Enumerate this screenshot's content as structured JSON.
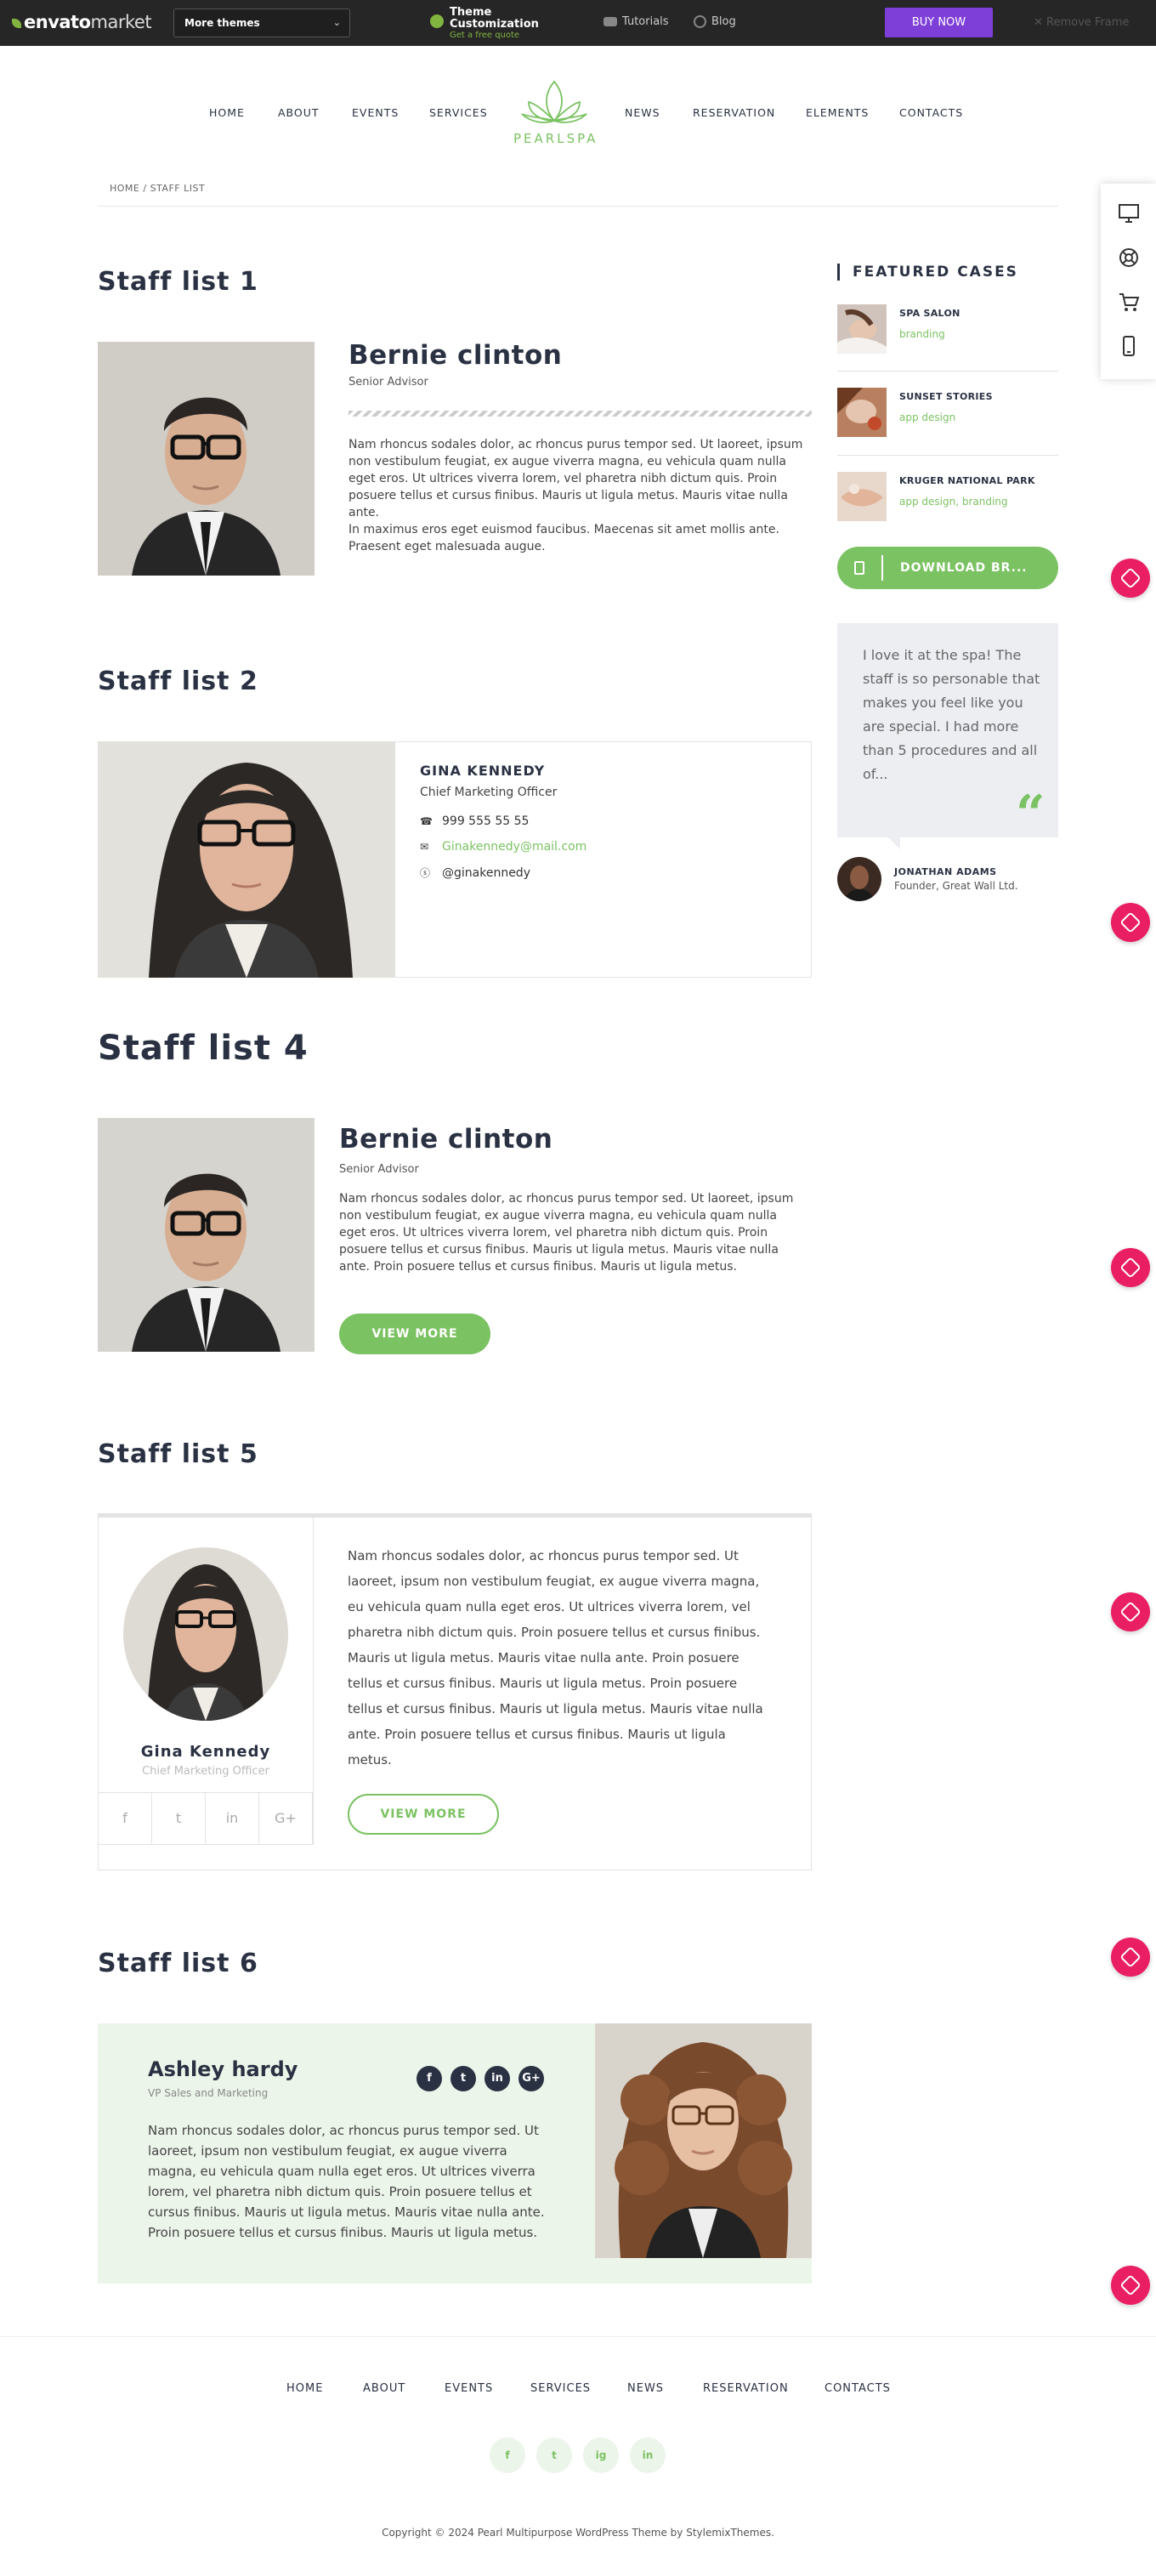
{
  "envato": {
    "logo_brand": "envato",
    "logo_market": "market",
    "more_themes": "More themes",
    "theme_customization": "Theme Customization",
    "free_quote": "Get a free quote",
    "tutorials": "Tutorials",
    "blog": "Blog",
    "buy_now": "BUY NOW",
    "remove_frame": "Remove Frame"
  },
  "nav": {
    "left": [
      "HOME",
      "ABOUT",
      "EVENTS",
      "SERVICES"
    ],
    "right": [
      "NEWS",
      "RESERVATION",
      "ELEMENTS",
      "CONTACTS"
    ],
    "logo_text": "PEARLSPA"
  },
  "breadcrumb": "HOME / STAFF LIST",
  "staff1": {
    "title": "Staff list 1",
    "name": "Bernie clinton",
    "position": "Senior Advisor",
    "bio": "Nam rhoncus sodales dolor, ac rhoncus purus tempor sed. Ut laoreet, ipsum non vestibulum feugiat, ex augue viverra magna, eu vehicula quam nulla eget eros. Ut ultrices viverra lorem, vel pharetra nibh dictum quis. Proin posuere tellus et cursus finibus. Mauris ut ligula metus. Mauris vitae nulla ante.",
    "bio2": "In maximus eros eget euismod faucibus. Maecenas sit amet mollis ante. Praesent eget malesuada augue."
  },
  "staff2": {
    "title": "Staff list 2",
    "name": "GINA KENNEDY",
    "position": "Chief Marketing Officer",
    "phone": "999 555 55 55",
    "email": "Ginakennedy@mail.com",
    "skype": "@ginakennedy"
  },
  "staff4": {
    "title": "Staff list 4",
    "name": "Bernie clinton",
    "position": "Senior Advisor",
    "bio": "Nam rhoncus sodales dolor, ac rhoncus purus tempor sed. Ut laoreet, ipsum non vestibulum feugiat, ex augue viverra magna, eu vehicula quam nulla eget eros. Ut ultrices viverra lorem, vel pharetra nibh dictum quis. Proin posuere tellus et cursus finibus. Mauris ut ligula metus. Mauris vitae nulla ante. Proin posuere tellus et cursus finibus. Mauris ut ligula metus.",
    "button": "VIEW MORE"
  },
  "staff5": {
    "title": "Staff list 5",
    "name": "Gina Kennedy",
    "position": "Chief Marketing Officer",
    "bio": "Nam rhoncus sodales dolor, ac rhoncus purus tempor sed. Ut laoreet, ipsum non vestibulum feugiat, ex augue viverra magna, eu vehicula quam nulla eget eros. Ut ultrices viverra lorem, vel pharetra nibh dictum quis. Proin posuere tellus et cursus finibus. Mauris ut ligula metus. Mauris vitae nulla ante. Proin posuere tellus et cursus finibus. Mauris ut ligula metus. Proin posuere tellus et cursus finibus. Mauris ut ligula metus. Mauris vitae nulla ante. Proin posuere tellus et cursus finibus. Mauris ut ligula metus.",
    "button": "VIEW MORE",
    "social": [
      "f",
      "t",
      "in",
      "G+"
    ]
  },
  "staff6": {
    "title": "Staff list 6",
    "name": "Ashley hardy",
    "position": "VP Sales and Marketing",
    "bio": "Nam rhoncus sodales dolor, ac rhoncus purus tempor sed. Ut laoreet, ipsum non vestibulum feugiat, ex augue viverra magna, eu vehicula quam nulla eget eros. Ut ultrices viverra lorem, vel pharetra nibh dictum quis. Proin posuere tellus et cursus finibus. Mauris ut ligula metus. Mauris vitae nulla ante. Proin posuere tellus et cursus finibus. Mauris ut ligula metus.",
    "social": [
      "f",
      "t",
      "in",
      "G+"
    ]
  },
  "sidebar": {
    "featured_title": "FEATURED CASES",
    "cases": [
      {
        "title": "SPA SALON",
        "category": "branding"
      },
      {
        "title": "SUNSET STORIES",
        "category": "app design"
      },
      {
        "title": "KRUGER NATIONAL PARK",
        "category": "app design, branding"
      }
    ],
    "download": "DOWNLOAD BR...",
    "quote": "I love it at the spa! The staff is so personable that makes you feel like you are special. I had more than 5 procedures and all of...",
    "quote_name": "JONATHAN ADAMS",
    "quote_position": "Founder, Great Wall Ltd."
  },
  "footer": {
    "nav": [
      "HOME",
      "ABOUT",
      "EVENTS",
      "SERVICES",
      "NEWS",
      "RESERVATION",
      "CONTACTS"
    ],
    "social": [
      "f",
      "t",
      "ig",
      "in"
    ],
    "copyright": "Copyright © 2024 Pearl Multipurpose WordPress Theme by StylemixThemes."
  },
  "colors": {
    "accent": "#7bc262",
    "dark": "#2a3142",
    "pink": "#e91e63",
    "envato_green": "#82b440",
    "buy": "#7e3fd8"
  }
}
